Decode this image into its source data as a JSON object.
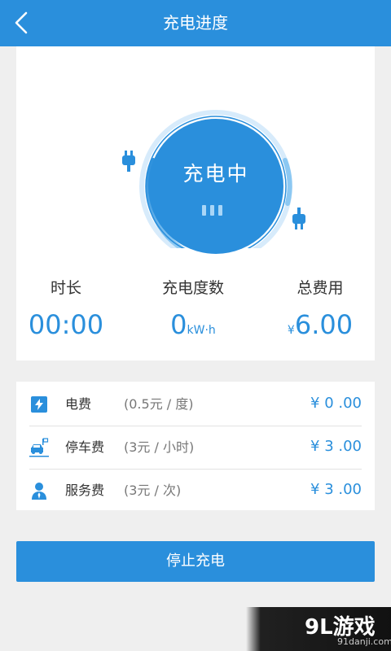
{
  "header": {
    "title": "充电进度",
    "back_icon": "chevron-left-icon"
  },
  "charging": {
    "status": "充电中",
    "icon": "plug-icon"
  },
  "stats": {
    "duration": {
      "label": "时长",
      "value": "00:00"
    },
    "energy": {
      "label": "充电度数",
      "value": "0",
      "unit": "kW·h"
    },
    "total": {
      "label": "总费用",
      "currency": "¥",
      "value": "6.00"
    }
  },
  "fees": [
    {
      "icon": "lightning-icon",
      "name": "电费",
      "rate": "(0.5元 / 度)",
      "amount": "¥ 0 .00"
    },
    {
      "icon": "car-parking-icon",
      "name": "停车费",
      "rate": "(3元 / 小时)",
      "amount": "¥ 3 .00"
    },
    {
      "icon": "service-person-icon",
      "name": "服务费",
      "rate": "(3元 / 次)",
      "amount": "¥ 3 .00"
    }
  ],
  "stop_button_label": "停止充电",
  "watermark": {
    "text": "9L游戏",
    "sub": "91danji.com"
  },
  "colors": {
    "accent": "#2a8fdc",
    "background": "#efefef"
  }
}
